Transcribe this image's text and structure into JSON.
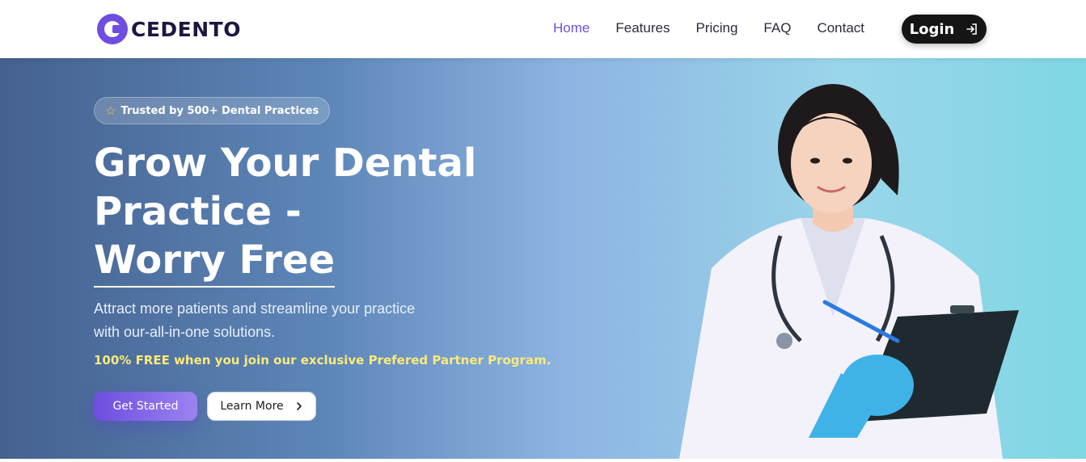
{
  "header": {
    "brand": "CEDENTO",
    "nav": [
      {
        "label": "Home",
        "active": true
      },
      {
        "label": "Features",
        "active": false
      },
      {
        "label": "Pricing",
        "active": false
      },
      {
        "label": "FAQ",
        "active": false
      },
      {
        "label": "Contact",
        "active": false
      }
    ],
    "login_label": "Login",
    "login_icon": "login-arrow-icon"
  },
  "hero": {
    "badge": {
      "icon": "star-icon",
      "text": "Trusted by 500+ Dental Practices"
    },
    "headline": {
      "line1": "Grow Your Dental",
      "line2": "Practice -",
      "line3": "Worry Free"
    },
    "subtext": "Attract more patients and streamline your practice with our-all-in-one solutions.",
    "promo": "100% FREE when you join our exclusive Prefered Partner Program.",
    "primary_button": "Get Started",
    "secondary_button": "Learn More",
    "secondary_icon": "chevron-right-icon"
  },
  "colors": {
    "brand": "#6d4ee0",
    "active_nav": "#6d4ee0",
    "promo": "#fbe97a",
    "login_bg": "#151515"
  }
}
